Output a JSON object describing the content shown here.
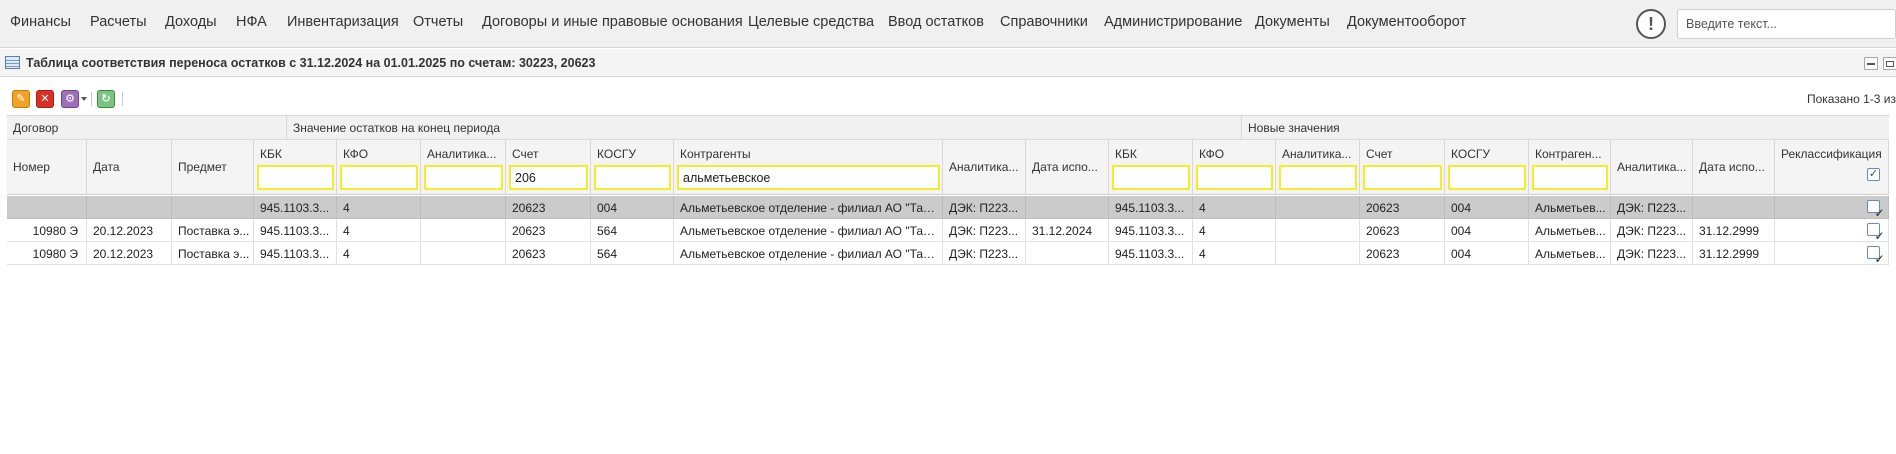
{
  "menu": {
    "items": [
      "Финансы",
      "Расчеты",
      "Доходы",
      "НФА",
      "Инвентаризация",
      "Отчеты",
      "Договоры и иные правовые основания",
      "Целевые средства",
      "Ввод остатков",
      "Справочники",
      "Администрирование",
      "Документы",
      "Документооборот"
    ],
    "alert_symbol": "!",
    "search_placeholder": "Введите текст..."
  },
  "window": {
    "title": "Таблица соответствия переноса остатков с 31.12.2024 на 01.01.2025 по счетам: 30223, 20623",
    "icon": "table-icon"
  },
  "toolbar": {
    "buttons": [
      "edit-icon",
      "delete-icon",
      "settings-icon",
      "refresh-icon"
    ],
    "shown_text": "Показано 1-3 из"
  },
  "grid": {
    "groups": [
      "Договор",
      "Значение остатков на конец периода",
      "Новые значения"
    ],
    "columns": [
      "Номер",
      "Дата",
      "Предмет",
      "КБК",
      "КФО",
      "Аналитика...",
      "Счет",
      "КОСГУ",
      "Контрагенты",
      "Аналитика...",
      "Дата испо...",
      "КБК",
      "КФО",
      "Аналитика...",
      "Счет",
      "КОСГУ",
      "Контраген...",
      "Аналитика...",
      "Дата испо...",
      "Реклассификация"
    ],
    "filters": {
      "schet": "206",
      "kontragenty": "альметьевское"
    },
    "rows": [
      {
        "cells": [
          "",
          "",
          "",
          "945.1103.3...",
          "4",
          "",
          "20623",
          "004",
          "Альметьевское отделение - филиал АО \"Татэнергосбыт\"",
          "ДЭК: П223...",
          "",
          "945.1103.3...",
          "4",
          "",
          "20623",
          "004",
          "Альметьев...",
          "ДЭК: П223...",
          ""
        ],
        "reclass": true,
        "selected": true
      },
      {
        "cells": [
          "10980 Э",
          "20.12.2023",
          "Поставка э...",
          "945.1103.3...",
          "4",
          "",
          "20623",
          "564",
          "Альметьевское отделение - филиал АО \"Татэнергосбыт\"",
          "ДЭК: П223...",
          "31.12.2024",
          "945.1103.3...",
          "4",
          "",
          "20623",
          "004",
          "Альметьев...",
          "ДЭК: П223...",
          "31.12.2999"
        ],
        "reclass": true,
        "selected": false
      },
      {
        "cells": [
          "10980 Э",
          "20.12.2023",
          "Поставка э...",
          "945.1103.3...",
          "4",
          "",
          "20623",
          "564",
          "Альметьевское отделение - филиал АО \"Татэнергосбыт\"",
          "ДЭК: П223...",
          "",
          "945.1103.3...",
          "4",
          "",
          "20623",
          "004",
          "Альметьев...",
          "ДЭК: П223...",
          "31.12.2999"
        ],
        "reclass": true,
        "selected": false
      }
    ]
  }
}
